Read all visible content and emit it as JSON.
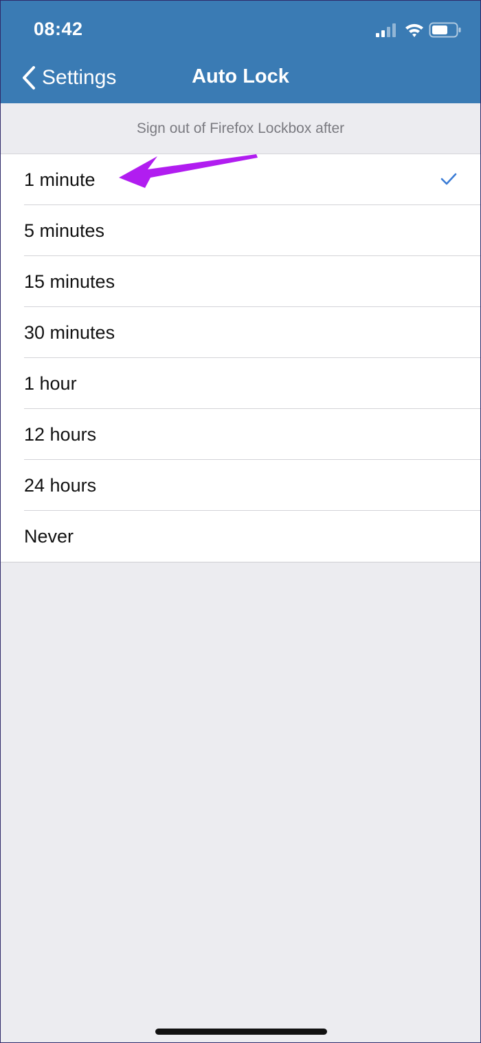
{
  "status_bar": {
    "time": "08:42",
    "icons": [
      "cellular-signal-icon",
      "wifi-icon",
      "battery-icon"
    ]
  },
  "nav": {
    "back_label": "Settings",
    "title": "Auto Lock"
  },
  "section": {
    "header": "Sign out of Firefox Lockbox after"
  },
  "options": [
    {
      "label": "1 minute",
      "selected": true
    },
    {
      "label": "5 minutes",
      "selected": false
    },
    {
      "label": "15 minutes",
      "selected": false
    },
    {
      "label": "30 minutes",
      "selected": false
    },
    {
      "label": "1 hour",
      "selected": false
    },
    {
      "label": "12 hours",
      "selected": false
    },
    {
      "label": "24 hours",
      "selected": false
    },
    {
      "label": "Never",
      "selected": false
    }
  ],
  "colors": {
    "header_bg": "#3a7bb4",
    "accent_check": "#3a7bd5",
    "annotation_arrow": "#b11df0",
    "page_bg": "#ececf0"
  }
}
